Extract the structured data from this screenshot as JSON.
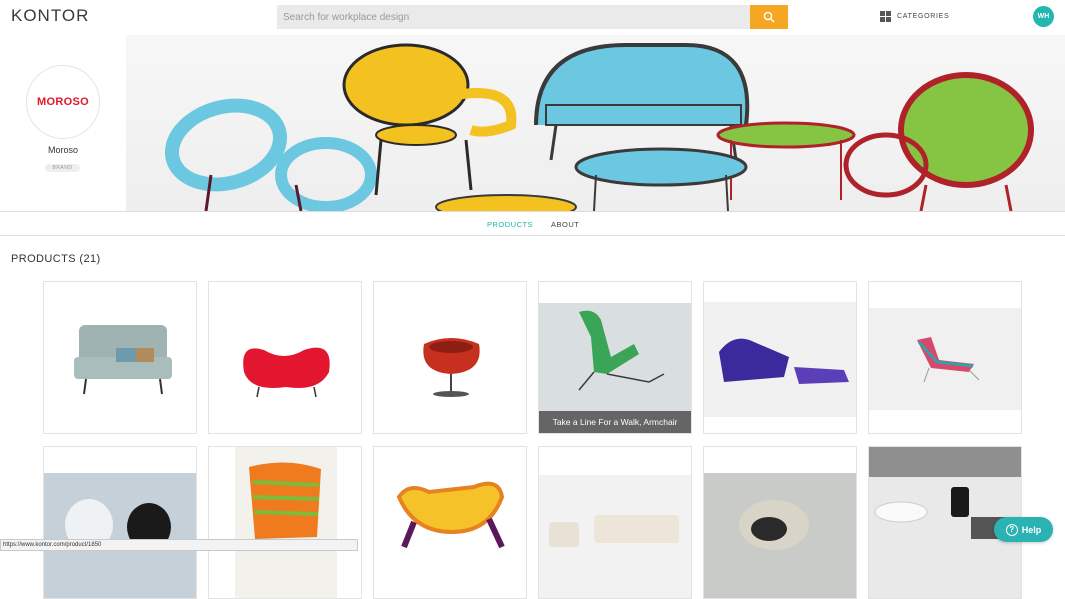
{
  "header": {
    "logo": "KONTOR",
    "search_placeholder": "Search for workplace design",
    "categories_label": "CATEGORIES",
    "avatar_initials": "WH"
  },
  "brand": {
    "logo_text": "MOROSO",
    "name": "Moroso",
    "badge": "BRAND"
  },
  "tabs": [
    {
      "label": "PRODUCTS",
      "active": true
    },
    {
      "label": "ABOUT",
      "active": false
    }
  ],
  "products": {
    "heading": "PRODUCTS (21)",
    "hover_caption": "Take a Line For a Walk, Armchair"
  },
  "status_url": "https://www.kontor.com/product/1850",
  "help_label": "Help",
  "colors": {
    "accent": "#1db3b3",
    "search_button": "#f5a623",
    "brand_red": "#e0162b"
  }
}
